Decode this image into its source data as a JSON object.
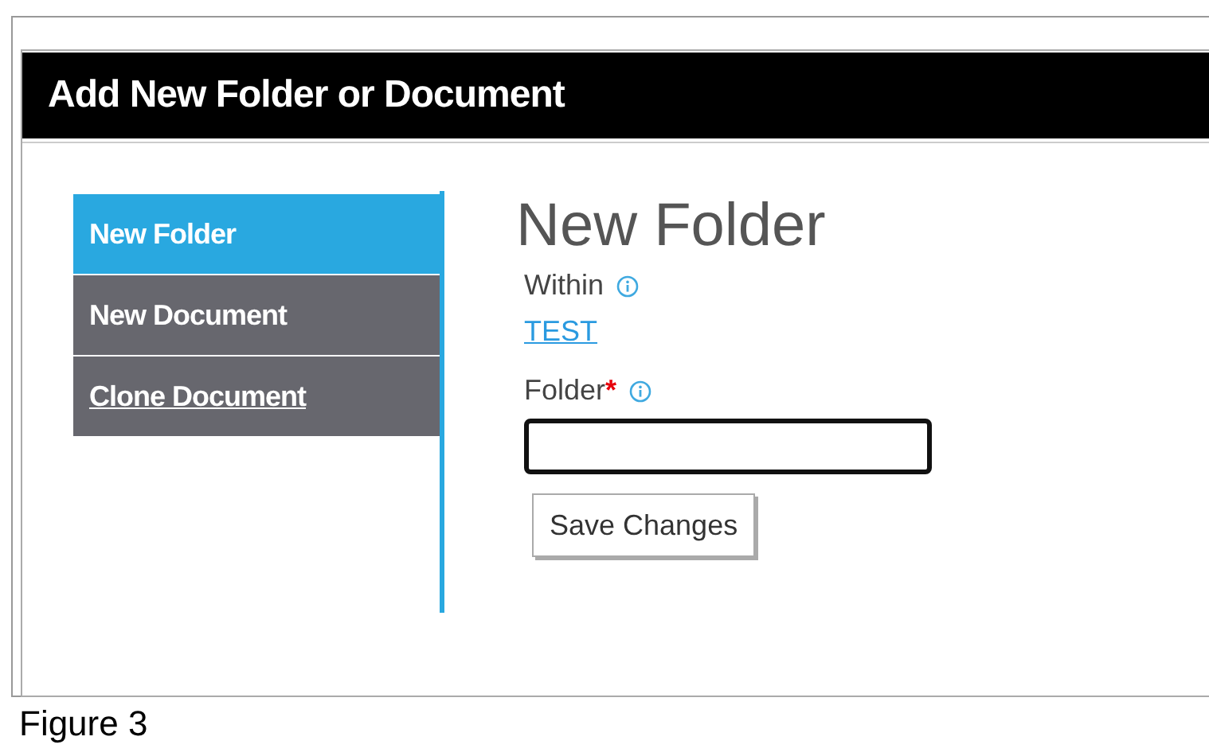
{
  "dialog": {
    "title": "Add New Folder or Document"
  },
  "menu": [
    {
      "label": "New Folder",
      "selected": true,
      "underlined": false
    },
    {
      "label": "New Document",
      "selected": false,
      "underlined": false
    },
    {
      "label": "Clone Document",
      "selected": false,
      "underlined": true
    }
  ],
  "form": {
    "heading": "New Folder",
    "within_label": "Within",
    "within_link": "TEST",
    "folder_label": "Folder",
    "required_mark": "*",
    "save_button": "Save Changes"
  },
  "caption": "Figure 3"
}
